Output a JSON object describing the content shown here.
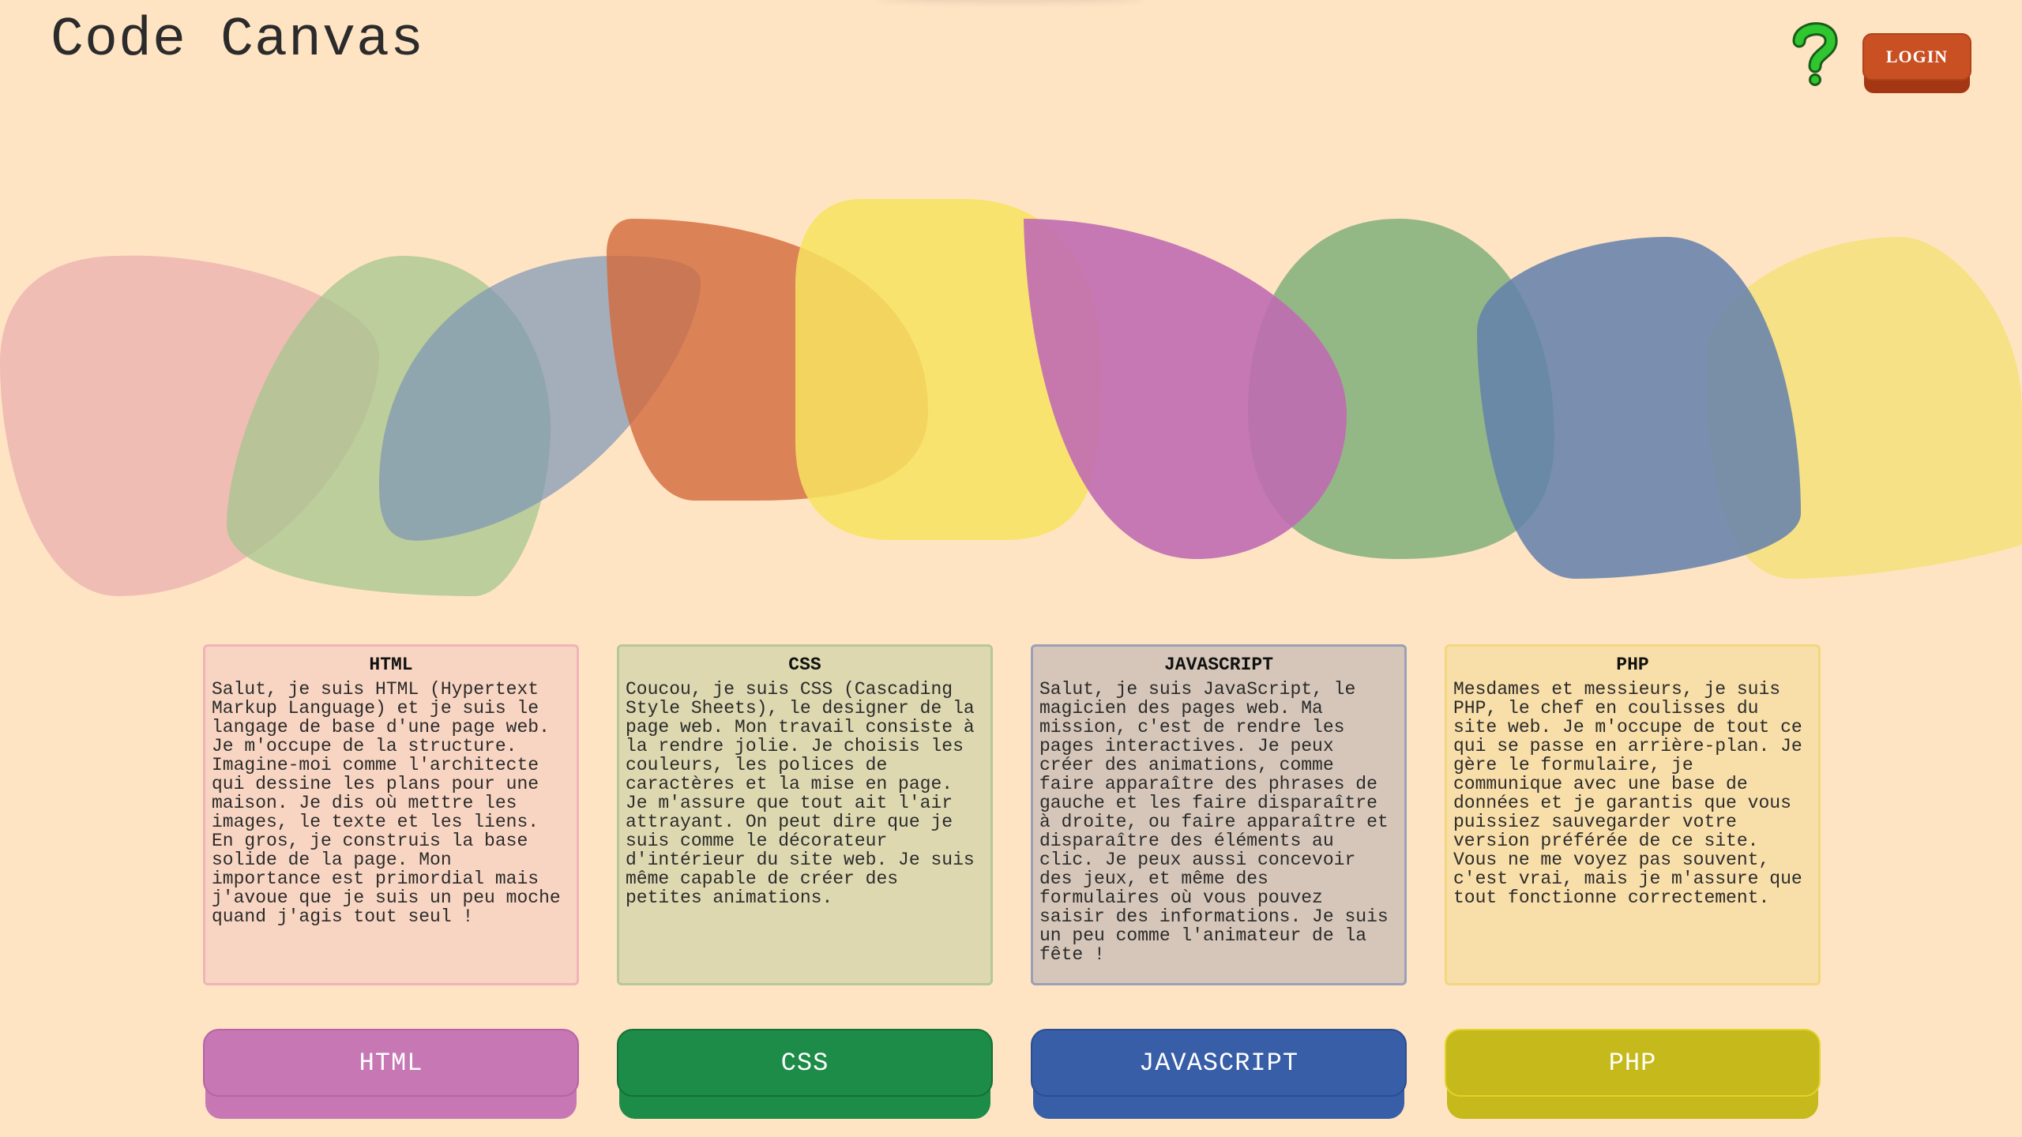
{
  "app": {
    "title": "Code Canvas"
  },
  "header": {
    "help_icon": "question-mark-icon",
    "login_label": "LOGIN"
  },
  "colors": {
    "background": "#ffe4c4",
    "help_icon": "#2fc62f",
    "login": "#c85023",
    "blob_pink": "#e8a8ac",
    "blob_sage": "#a6c78e",
    "blob_slate": "#7e95b6",
    "blob_orange": "#d3693c",
    "blob_yellow": "#f7e35f",
    "blob_magenta": "#c06bb3",
    "blob_green": "#80b07a",
    "blob_blue": "#6380ad",
    "blob_light_yellow": "#f5e07c"
  },
  "cards": [
    {
      "title": "HTML",
      "text": "Salut, je suis HTML (Hypertext Markup Language) et je suis le langage de base d'une page web. Je m'occupe de la structure. Imagine-moi comme l'architecte qui dessine les plans pour une maison. Je dis où mettre les images, le texte et les liens. En gros, je construis la base solide de la page. Mon importance est primordial mais j'avoue que je suis un peu moche quand j'agis tout seul !",
      "bg": "#f8d5c2",
      "border": "#efb4ba"
    },
    {
      "title": "CSS",
      "text": "Coucou, je suis CSS (Cascading Style Sheets), le designer de la page web. Mon travail consiste à la rendre jolie. Je choisis les couleurs, les polices de caractères et la mise en page. Je m'assure que tout ait l'air attrayant. On peut dire que je suis comme le décorateur d'intérieur du site web. Je suis même capable de créer des petites animations.",
      "bg": "#ddd8b0",
      "border": "#b7c79a"
    },
    {
      "title": "JAVASCRIPT",
      "text": "Salut, je suis JavaScript, le magicien des pages web. Ma mission, c'est de rendre les pages interactives. Je peux créer des animations, comme faire apparaître des phrases de gauche et les faire disparaître à droite, ou faire apparaître et disparaître des éléments au clic. Je peux aussi concevoir des jeux, et même des formulaires où vous pouvez saisir des informations. Je suis un peu comme l'animateur de la fête !",
      "bg": "#d5c6b9",
      "border": "#9aa0b8"
    },
    {
      "title": "PHP",
      "text": "Mesdames et messieurs, je suis PHP, le chef en coulisses du site web. Je m'occupe de tout ce qui se passe en arrière-plan. Je gère le formulaire, je communique avec une base de données et je garantis que vous puissiez sauvegarder votre version préférée de ce site. Vous ne me voyez pas souvent, c'est vrai, mais je m'assure que tout fonctionne correctement.",
      "bg": "#f8dea8",
      "border": "#f2d680"
    }
  ],
  "buttons": [
    {
      "label": "HTML",
      "face": "#c777b4",
      "base": "#c777b4",
      "border": "#b863a6"
    },
    {
      "label": "CSS",
      "face": "#1d8c48",
      "base": "#1d8c48",
      "border": "#157036"
    },
    {
      "label": "JAVASCRIPT",
      "face": "#375ea7",
      "base": "#375ea7",
      "border": "#2a4e93"
    },
    {
      "label": "PHP",
      "face": "#c5b91b",
      "base": "#c5b91b",
      "border": "#e3d42a"
    }
  ]
}
